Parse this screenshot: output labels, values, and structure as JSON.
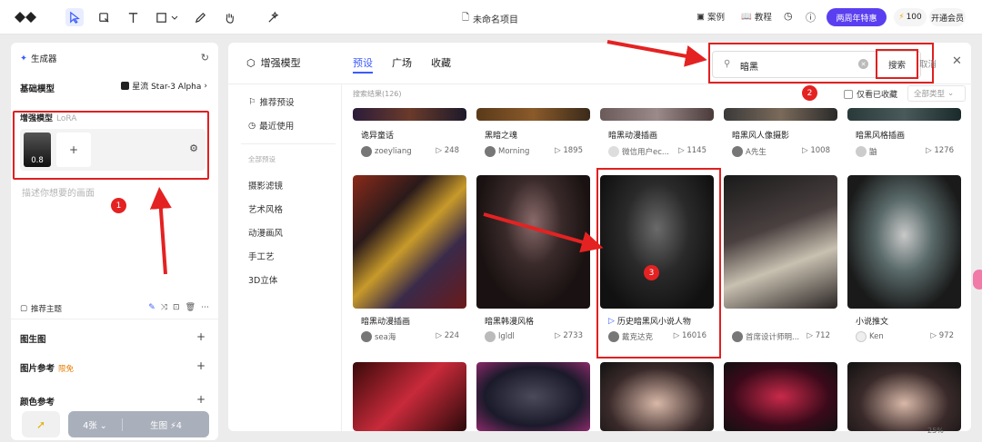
{
  "toolbar": {
    "project_title": "未命名项目",
    "cases": "案例",
    "tutorial": "教程",
    "anniversary": "两周年特惠",
    "credits": "100",
    "vip": "开通会员"
  },
  "left_panel": {
    "header": "生成器",
    "base_model_label": "基础模型",
    "base_model_value": "星流 Star-3 Alpha",
    "lora_label": "增强模型",
    "lora_sub": "LoRA",
    "lora_weight": "0.8",
    "lora_add": "+",
    "prompt_placeholder": "描述你想要的画面",
    "topic_label": "推荐主题",
    "sections": [
      {
        "label": "图生图",
        "extra": ""
      },
      {
        "label": "图片参考",
        "extra": "限免"
      },
      {
        "label": "颜色参考",
        "extra": ""
      }
    ],
    "quantity": "4张",
    "generate": "生图",
    "generate_cost": "4"
  },
  "modal": {
    "title": "增强模型",
    "tabs": [
      "预设",
      "广场",
      "收藏"
    ],
    "active_tab": 0,
    "search_value": "暗黑",
    "search_button": "搜索",
    "cancel": "取消",
    "sidebar": {
      "recommended": "推荐预设",
      "recent": "最近使用",
      "category_header": "全部预设",
      "categories": [
        "摄影滤镜",
        "艺术风格",
        "动漫画风",
        "手工艺",
        "3D立体"
      ]
    },
    "results_count": "搜索结果(126)",
    "fav_only": "仅看已收藏",
    "type_filter": "全部类型",
    "row1": [
      {
        "title": "诡异童话",
        "author": "zoeyliang",
        "views": "248"
      },
      {
        "title": "黑暗之魂",
        "author": "Morning",
        "views": "1895"
      },
      {
        "title": "暗黑动漫插画",
        "author": "微信用户ec...",
        "views": "1145"
      },
      {
        "title": "暗黑风人像摄影",
        "author": "A先生",
        "views": "1008"
      },
      {
        "title": "暗黑风格插画",
        "author": "鼬",
        "views": "1276"
      }
    ],
    "row2": [
      {
        "title": "暗黑动漫插画",
        "author": "sea海",
        "views": "224"
      },
      {
        "title": "暗黑韩漫风格",
        "author": "lgldl",
        "views": "2733"
      },
      {
        "title": "历史暗黑风小说人物",
        "author": "戴克达克",
        "views": "16016"
      },
      {
        "title": "",
        "author": "首席设计师明...",
        "views": "712"
      },
      {
        "title": "小说推文",
        "author": "Ken",
        "views": "972"
      }
    ]
  },
  "annotations": {
    "b1": "1",
    "b2": "2",
    "b3": "3"
  },
  "zoom": "25%"
}
